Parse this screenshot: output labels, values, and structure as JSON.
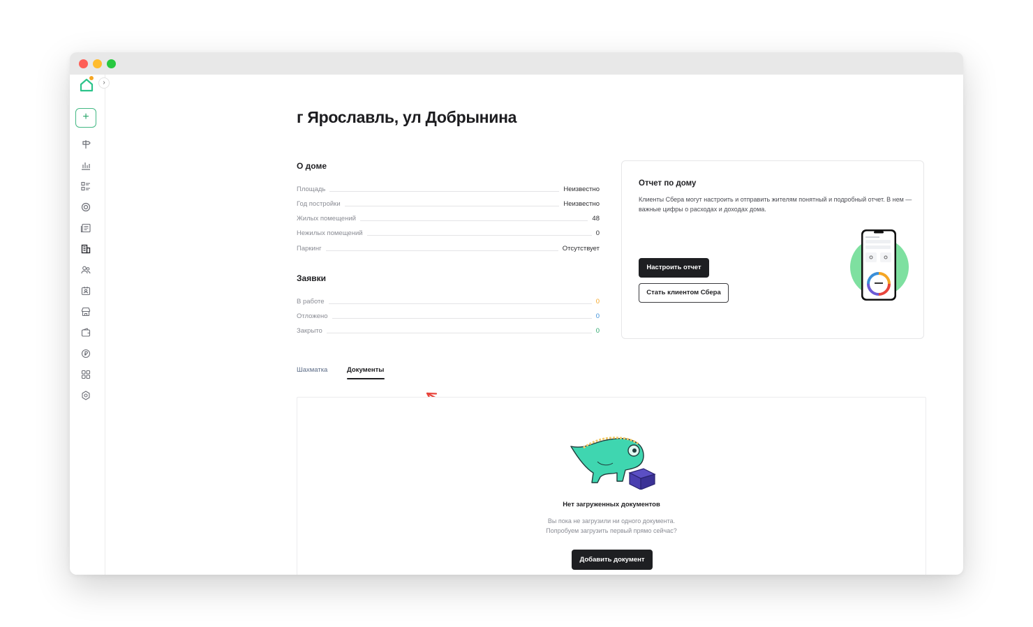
{
  "page": {
    "title": "г Ярославль, ул Добрынина"
  },
  "about_house": {
    "title": "О доме",
    "rows": [
      {
        "label": "Площадь",
        "value": "Неизвестно"
      },
      {
        "label": "Год постройки",
        "value": "Неизвестно"
      },
      {
        "label": "Жилых помещений",
        "value": "48"
      },
      {
        "label": "Нежилых помещений",
        "value": "0"
      },
      {
        "label": "Паркинг",
        "value": "Отсутствует"
      }
    ]
  },
  "requests": {
    "title": "Заявки",
    "rows": [
      {
        "label": "В работе",
        "value": "0",
        "color": "#f5a623"
      },
      {
        "label": "Отложено",
        "value": "0",
        "color": "#3b8fd9"
      },
      {
        "label": "Закрыто",
        "value": "0",
        "color": "#2aa66a"
      }
    ]
  },
  "report": {
    "title": "Отчет по дому",
    "text": "Клиенты Сбера могут настроить и отправить жителям понятный и подробный отчет. В нем — важные цифры о расходах и доходах дома.",
    "setup_button": "Настроить отчет",
    "client_button": "Стать клиентом Сбера"
  },
  "tabs": [
    {
      "label": "Шахматка",
      "active": false
    },
    {
      "label": "Документы",
      "active": true
    }
  ],
  "documents": {
    "empty_title": "Нет загруженных документов",
    "empty_line1": "Вы пока не загрузили ни одного документа.",
    "empty_line2": "Попробуем загрузить первый прямо сейчас?",
    "add_button": "Добавить документ"
  },
  "sidebar": {
    "expand_glyph": "›",
    "add_glyph": "+",
    "icons": [
      "signpost-icon",
      "bar-chart-icon",
      "list-icon",
      "target-icon",
      "news-icon",
      "building-icon",
      "users-icon",
      "id-card-icon",
      "store-icon",
      "wallet-icon",
      "currency-icon",
      "apps-grid-icon",
      "settings-icon"
    ]
  },
  "colors": {
    "accent_green": "#2aa66a",
    "button_dark": "#1e1f22",
    "annotation_arrow": "#e8453c"
  }
}
